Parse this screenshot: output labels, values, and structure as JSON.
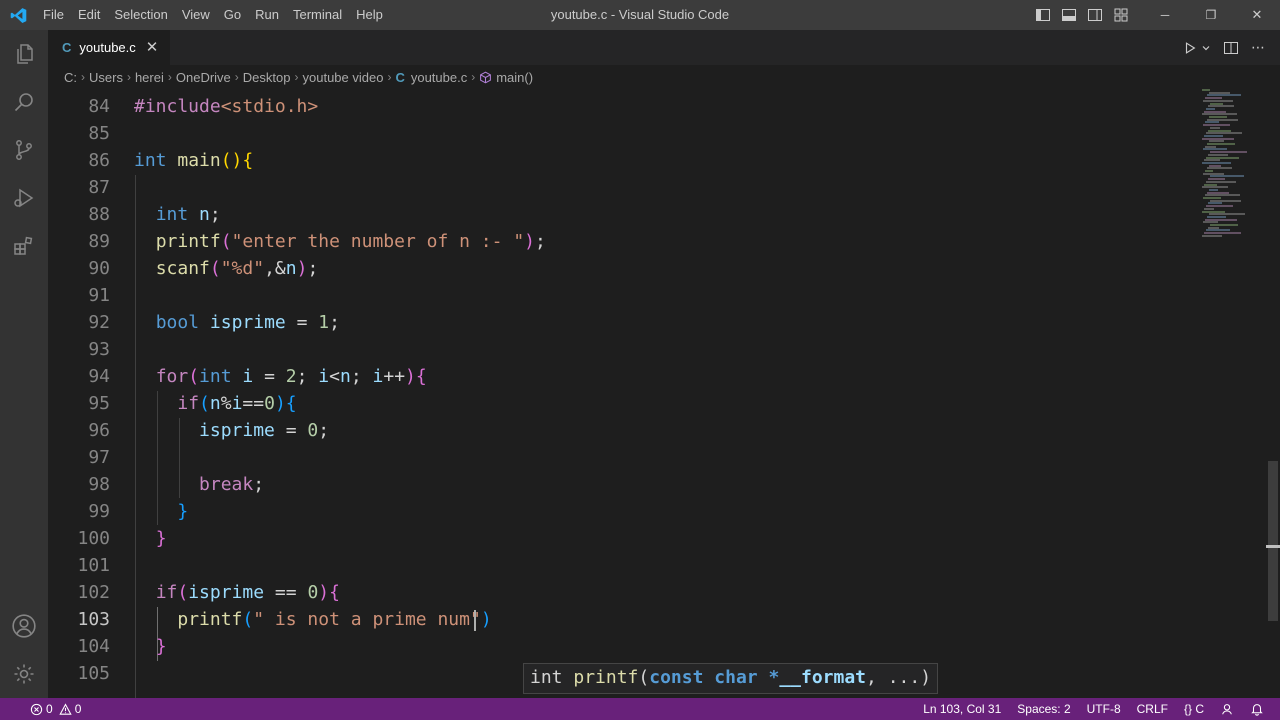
{
  "window": {
    "title": "youtube.c - Visual Studio Code",
    "menu": [
      "File",
      "Edit",
      "Selection",
      "View",
      "Go",
      "Run",
      "Terminal",
      "Help"
    ],
    "controls": {
      "minimize": "─",
      "restore": "❐",
      "close": "✕"
    }
  },
  "tab": {
    "icon": "C",
    "label": "youtube.c",
    "close": "✕"
  },
  "breadcrumb": {
    "parts": [
      "C:",
      "Users",
      "herei",
      "OneDrive",
      "Desktop",
      "youtube video"
    ],
    "file_icon": "C",
    "file": "youtube.c",
    "symbol": "main()",
    "separator": "›"
  },
  "editor": {
    "line_numbers": [
      "84",
      "85",
      "86",
      "87",
      "88",
      "89",
      "90",
      "91",
      "92",
      "93",
      "94",
      "95",
      "96",
      "97",
      "98",
      "99",
      "100",
      "101",
      "102",
      "103",
      "104",
      "105"
    ],
    "active_line": "103",
    "lines": [
      [
        [
          "c",
          "#include"
        ],
        [
          "s",
          "<stdio.h>"
        ]
      ],
      [],
      [
        [
          "k",
          "int"
        ],
        [
          "t",
          " "
        ],
        [
          "f",
          "main"
        ],
        [
          "b1",
          "()"
        ],
        [
          "b1",
          "{"
        ]
      ],
      [],
      [
        [
          "t",
          "  "
        ],
        [
          "k",
          "int"
        ],
        [
          "t",
          " "
        ],
        [
          "v",
          "n"
        ],
        [
          "t",
          ";"
        ]
      ],
      [
        [
          "t",
          "  "
        ],
        [
          "f",
          "printf"
        ],
        [
          "b2",
          "("
        ],
        [
          "s",
          "\"enter the number of n :- \""
        ],
        [
          "b2",
          ")"
        ],
        [
          "t",
          ";"
        ]
      ],
      [
        [
          "t",
          "  "
        ],
        [
          "f",
          "scanf"
        ],
        [
          "b2",
          "("
        ],
        [
          "s",
          "\"%d\""
        ],
        [
          "t",
          ","
        ],
        [
          "t",
          "&"
        ],
        [
          "v",
          "n"
        ],
        [
          "b2",
          ")"
        ],
        [
          "t",
          ";"
        ]
      ],
      [],
      [
        [
          "t",
          "  "
        ],
        [
          "k",
          "bool"
        ],
        [
          "t",
          " "
        ],
        [
          "v",
          "isprime"
        ],
        [
          "t",
          " = "
        ],
        [
          "n",
          "1"
        ],
        [
          "t",
          ";"
        ]
      ],
      [],
      [
        [
          "t",
          "  "
        ],
        [
          "c",
          "for"
        ],
        [
          "b2",
          "("
        ],
        [
          "k",
          "int"
        ],
        [
          "t",
          " "
        ],
        [
          "v",
          "i"
        ],
        [
          "t",
          " = "
        ],
        [
          "n",
          "2"
        ],
        [
          "t",
          "; "
        ],
        [
          "v",
          "i"
        ],
        [
          "t",
          "<"
        ],
        [
          "v",
          "n"
        ],
        [
          "t",
          "; "
        ],
        [
          "v",
          "i"
        ],
        [
          "t",
          "++"
        ],
        [
          "b2",
          ")"
        ],
        [
          "b2",
          "{"
        ]
      ],
      [
        [
          "t",
          "    "
        ],
        [
          "c",
          "if"
        ],
        [
          "b3",
          "("
        ],
        [
          "v",
          "n"
        ],
        [
          "t",
          "%"
        ],
        [
          "v",
          "i"
        ],
        [
          "t",
          "=="
        ],
        [
          "n",
          "0"
        ],
        [
          "b3",
          ")"
        ],
        [
          "b3",
          "{"
        ]
      ],
      [
        [
          "t",
          "      "
        ],
        [
          "v",
          "isprime"
        ],
        [
          "t",
          " = "
        ],
        [
          "n",
          "0"
        ],
        [
          "t",
          ";"
        ]
      ],
      [],
      [
        [
          "t",
          "      "
        ],
        [
          "c",
          "break"
        ],
        [
          "t",
          ";"
        ]
      ],
      [
        [
          "t",
          "    "
        ],
        [
          "b3",
          "}"
        ]
      ],
      [
        [
          "t",
          "  "
        ],
        [
          "b2",
          "}"
        ]
      ],
      [],
      [
        [
          "t",
          "  "
        ],
        [
          "c",
          "if"
        ],
        [
          "b2",
          "("
        ],
        [
          "v",
          "isprime"
        ],
        [
          "t",
          " == "
        ],
        [
          "n",
          "0"
        ],
        [
          "b2",
          ")"
        ],
        [
          "b2",
          "{"
        ]
      ],
      [
        [
          "t",
          "    "
        ],
        [
          "f",
          "printf"
        ],
        [
          "b3",
          "("
        ],
        [
          "s",
          "\" is not a prime num\""
        ],
        [
          "b3",
          ")"
        ]
      ],
      [
        [
          "t",
          "  "
        ],
        [
          "b2",
          "}"
        ]
      ],
      []
    ]
  },
  "hover": [
    [
      "t",
      "int "
    ],
    [
      "f",
      "printf"
    ],
    [
      "t",
      "("
    ],
    [
      "k",
      "const"
    ],
    [
      "t",
      " "
    ],
    [
      "k",
      "char"
    ],
    [
      "t",
      " "
    ],
    [
      "k",
      "*"
    ],
    [
      "v",
      "__format"
    ],
    [
      "t",
      ", ...)"
    ]
  ],
  "statusbar": {
    "errors": "0",
    "warnings": "0",
    "position": "Ln 103, Col 31",
    "spaces": "Spaces: 2",
    "encoding": "UTF-8",
    "eol": "CRLF",
    "language": "{} C"
  },
  "colors": {
    "statusbar": "#68217a",
    "titlebar": "#3c3c3c",
    "activitybar": "#333333",
    "editor": "#1e1e1e"
  }
}
